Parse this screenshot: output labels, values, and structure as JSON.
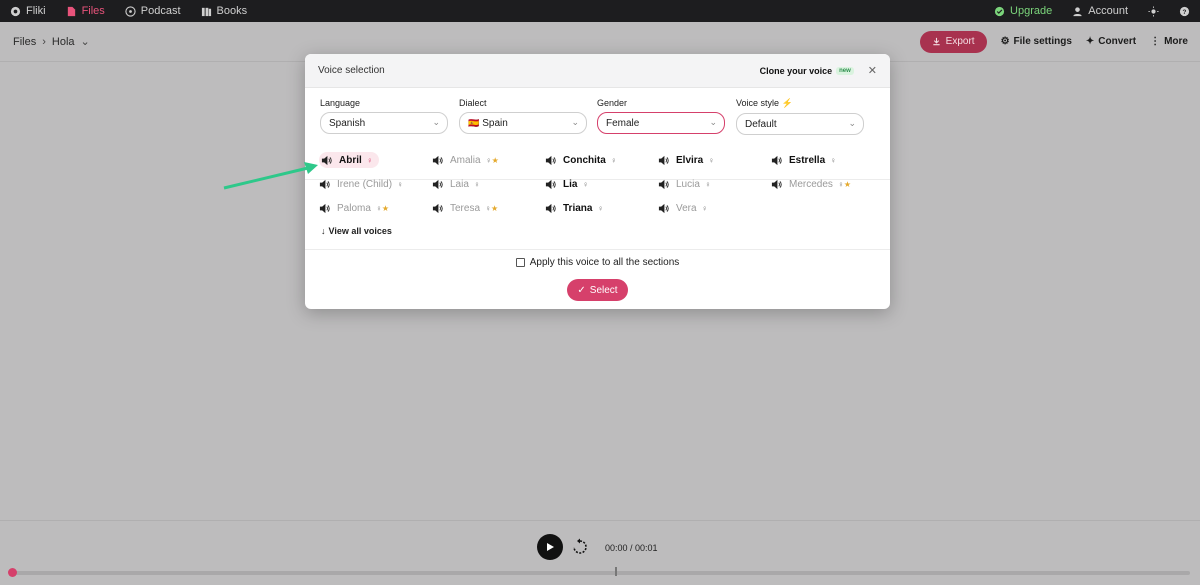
{
  "topbar": {
    "brand": "Fliki",
    "nav": [
      {
        "label": "Files",
        "icon": "file-icon",
        "active": true
      },
      {
        "label": "Podcast",
        "icon": "podcast-icon",
        "active": false
      },
      {
        "label": "Books",
        "icon": "books-icon",
        "active": false
      }
    ],
    "upgrade": "Upgrade",
    "account": "Account"
  },
  "header": {
    "breadcrumb_root": "Files",
    "breadcrumb_current": "Hola",
    "export": "Export",
    "file_settings": "File settings",
    "convert": "Convert",
    "more": "More"
  },
  "modal": {
    "title": "Voice selection",
    "clone": "Clone your voice",
    "clone_badge": "new",
    "filters": [
      {
        "label": "Language",
        "value": "Spanish",
        "flag": ""
      },
      {
        "label": "Dialect",
        "value": "Spain",
        "flag": "🇪🇸"
      },
      {
        "label": "Gender",
        "value": "Female",
        "flag": ""
      },
      {
        "label": "Voice style",
        "value": "Default",
        "flag": ""
      }
    ],
    "voices": [
      {
        "name": "Abril",
        "selected": true,
        "muted": false,
        "star": false
      },
      {
        "name": "Amalia",
        "selected": false,
        "muted": true,
        "star": true
      },
      {
        "name": "Conchita",
        "selected": false,
        "muted": false,
        "star": false
      },
      {
        "name": "Elvira",
        "selected": false,
        "muted": false,
        "star": false
      },
      {
        "name": "Estrella",
        "selected": false,
        "muted": false,
        "star": false
      },
      {
        "name": "Irene (Child)",
        "selected": false,
        "muted": true,
        "star": false
      },
      {
        "name": "Laia",
        "selected": false,
        "muted": true,
        "star": false
      },
      {
        "name": "Lia",
        "selected": false,
        "muted": false,
        "star": false
      },
      {
        "name": "Lucia",
        "selected": false,
        "muted": true,
        "star": false
      },
      {
        "name": "Mercedes",
        "selected": false,
        "muted": true,
        "star": true
      },
      {
        "name": "Paloma",
        "selected": false,
        "muted": true,
        "star": true
      },
      {
        "name": "Teresa",
        "selected": false,
        "muted": true,
        "star": true
      },
      {
        "name": "Triana",
        "selected": false,
        "muted": false,
        "star": false
      },
      {
        "name": "Vera",
        "selected": false,
        "muted": true,
        "star": false
      }
    ],
    "view_all": "View all voices",
    "apply_all": "Apply this voice to all the sections",
    "select": "Select"
  },
  "player": {
    "time": "00:00 / 00:01"
  },
  "colors": {
    "accent": "#d6406b",
    "topbar_bg": "#1d1d1f",
    "upgrade": "#7bd47b",
    "arrow": "#2ec88a"
  }
}
